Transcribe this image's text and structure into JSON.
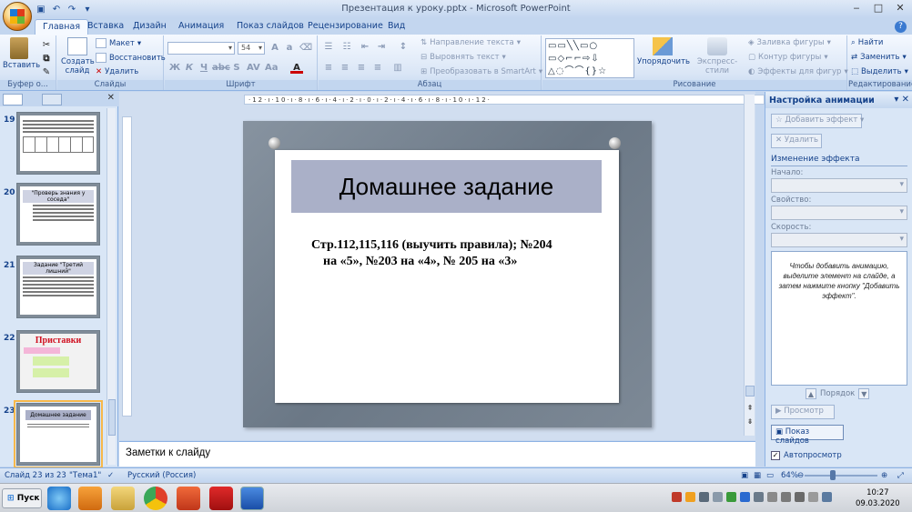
{
  "window": {
    "title": "Презентация к уроку.pptx - Microsoft PowerPoint"
  },
  "tabs": [
    "Главная",
    "Вставка",
    "Дизайн",
    "Анимация",
    "Показ слайдов",
    "Рецензирование",
    "Вид"
  ],
  "ribbon": {
    "clipboard": {
      "paste": "Вставить",
      "label": "Буфер о..."
    },
    "slides": {
      "create": "Создать",
      "create2": "слайд",
      "layout": "Макет",
      "reset": "Восстановить",
      "delete": "Удалить",
      "label": "Слайды"
    },
    "font": {
      "size": "54",
      "label": "Шрифт"
    },
    "paragraph": {
      "text_dir": "Направление текста",
      "align_text": "Выровнять текст",
      "smartart": "Преобразовать в SmartArt",
      "label": "Абзац"
    },
    "drawing": {
      "arrange": "Упорядочить",
      "quick_styles": "Экспресс-стили",
      "fill": "Заливка фигуры",
      "outline": "Контур фигуры",
      "effects": "Эффекты для фигур",
      "label": "Рисование"
    },
    "editing": {
      "find": "Найти",
      "replace": "Заменить",
      "select": "Выделить",
      "label": "Редактирование"
    }
  },
  "slides_panel": {
    "items": [
      {
        "num": "19",
        "title": ""
      },
      {
        "num": "20",
        "title": "\"Проверь знания у соседа\""
      },
      {
        "num": "21",
        "title": "Задание \"Третий лишний\""
      },
      {
        "num": "22",
        "title": "Приставки"
      },
      {
        "num": "23",
        "title": "Домашнее задание"
      }
    ]
  },
  "slide": {
    "title": "Домашнее задание",
    "body_line1": "Стр.112,115,116 (выучить правила); №204",
    "body_line2": "на «5», №203 на «4», № 205 на «3»"
  },
  "notes": {
    "placeholder": "Заметки к слайду"
  },
  "animation_pane": {
    "title": "Настройка анимации",
    "add_effect": "Добавить эффект",
    "remove": "Удалить",
    "change_effect": "Изменение эффекта",
    "start_label": "Начало:",
    "property_label": "Свойство:",
    "speed_label": "Скорость:",
    "hint": "Чтобы добавить анимацию, выделите элемент на слайде, а затем нажмите кнопку \"Добавить эффект\".",
    "order": "Порядок",
    "preview": "Просмотр",
    "slideshow": "Показ слайдов",
    "autopreview": "Автопросмотр"
  },
  "status": {
    "slide_info": "Слайд 23 из 23",
    "theme": "\"Тема1\"",
    "language": "Русский (Россия)",
    "zoom": "64%"
  },
  "taskbar": {
    "start": "Пуск",
    "time": "10:27",
    "date": "09.03.2020"
  },
  "colors": {
    "ribbon_bg": "#dae6f6",
    "title_box": "#aab0c8",
    "accent": "#15428b"
  }
}
